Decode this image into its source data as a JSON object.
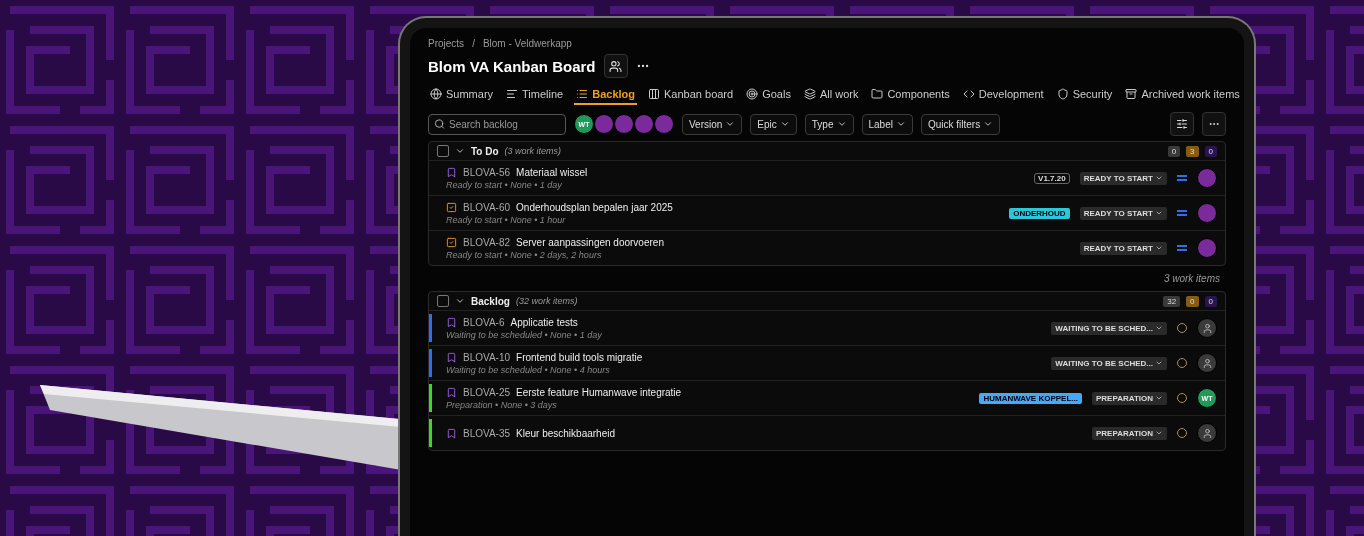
{
  "breadcrumbs": [
    "Projects",
    "Blom - Veldwerkapp"
  ],
  "breadcrumb_separator": "/",
  "board_title": "Blom VA Kanban Board",
  "tabs": [
    {
      "label": "Summary",
      "kind": "globe",
      "selected": false
    },
    {
      "label": "Timeline",
      "kind": "timeline",
      "selected": false
    },
    {
      "label": "Backlog",
      "kind": "list",
      "selected": true
    },
    {
      "label": "Kanban board",
      "kind": "columns",
      "selected": false
    },
    {
      "label": "Goals",
      "kind": "target",
      "selected": false
    },
    {
      "label": "All work",
      "kind": "layers",
      "selected": false
    },
    {
      "label": "Components",
      "kind": "folder",
      "selected": false
    },
    {
      "label": "Development",
      "kind": "code",
      "selected": false
    },
    {
      "label": "Security",
      "kind": "shield",
      "selected": false
    },
    {
      "label": "Archived work items",
      "kind": "archive",
      "selected": false
    }
  ],
  "search": {
    "placeholder": "Search backlog"
  },
  "avatars": [
    {
      "kind": "initials",
      "initials": "WT"
    },
    {
      "kind": "photo"
    },
    {
      "kind": "photo"
    },
    {
      "kind": "photo"
    },
    {
      "kind": "photo"
    }
  ],
  "filters": [
    "Version",
    "Epic",
    "Type",
    "Label",
    "Quick filters"
  ],
  "sections": [
    {
      "title": "To Do",
      "count": "(3 work items)",
      "checked": false,
      "expanded": true,
      "totals": [
        {
          "value": "0",
          "color": "#3a3a3a"
        },
        {
          "value": "3",
          "color": "#8a5a12"
        },
        {
          "value": "0",
          "color": "#2a1450"
        }
      ],
      "footer": "3 work items",
      "items": [
        {
          "key": "BLOVA-56",
          "kind": "story",
          "summary": "Materiaal wissel",
          "meta": "Ready to start • None • 1 day",
          "version": "V1.7.20",
          "status": "READY TO START",
          "priority": {
            "kind": "medium"
          },
          "estimate_empty": false,
          "assignee": {
            "kind": "photo"
          }
        },
        {
          "key": "BLOVA-60",
          "kind": "task",
          "summary": "Onderhoudsplan bepalen jaar 2025",
          "meta": "Ready to start • None • 1 hour",
          "label": {
            "text": "ONDERHOUD",
            "color": "#2ec7d8"
          },
          "status": "READY TO START",
          "priority": {
            "kind": "medium"
          },
          "estimate_empty": false,
          "assignee": {
            "kind": "photo"
          }
        },
        {
          "key": "BLOVA-82",
          "kind": "task",
          "summary": "Server aanpassingen doorvoeren",
          "meta": "Ready to start • None • 2 days, 2 hours",
          "status": "READY TO START",
          "priority": {
            "kind": "medium"
          },
          "estimate_empty": false,
          "assignee": {
            "kind": "photo"
          }
        }
      ]
    },
    {
      "title": "Backlog",
      "count": "(32 work items)",
      "checked": false,
      "expanded": true,
      "totals": [
        {
          "value": "32",
          "color": "#3a3a3a"
        },
        {
          "value": "0",
          "color": "#8a5a12"
        },
        {
          "value": "0",
          "color": "#2a1450"
        }
      ],
      "items": [
        {
          "key": "BLOVA-6",
          "kind": "story",
          "summary": "Applicatie tests",
          "meta": "Waiting to be scheduled • None • 1 day",
          "status": "WAITING TO BE SCHED...",
          "estimate_empty": true,
          "epic": {
            "color": "#2f6fe0"
          },
          "assignee": {
            "kind": "unassigned"
          }
        },
        {
          "key": "BLOVA-10",
          "kind": "story",
          "summary": "Frontend build tools migratie",
          "meta": "Waiting to be scheduled • None • 4 hours",
          "status": "WAITING TO BE SCHED...",
          "estimate_empty": true,
          "epic": {
            "color": "#2f6fe0"
          },
          "assignee": {
            "kind": "unassigned"
          }
        },
        {
          "key": "BLOVA-25",
          "kind": "story",
          "summary": "Eerste feature Humanwave integratie",
          "meta": "Preparation • None • 3 days",
          "label": {
            "text": "HUMANWAVE KOPPEL...",
            "color": "#4aa8f0"
          },
          "status": "PREPARATION",
          "estimate_empty": true,
          "epic": {
            "color": "#3fd62a"
          },
          "assignee": {
            "kind": "initials",
            "initials": "WT"
          }
        },
        {
          "key": "BLOVA-35",
          "kind": "story",
          "summary": "Kleur beschikbaarheid",
          "status": "PREPARATION",
          "estimate_empty": true,
          "epic": {
            "color": "#3fd62a"
          },
          "assignee": {
            "kind": "unassigned"
          }
        }
      ]
    }
  ]
}
